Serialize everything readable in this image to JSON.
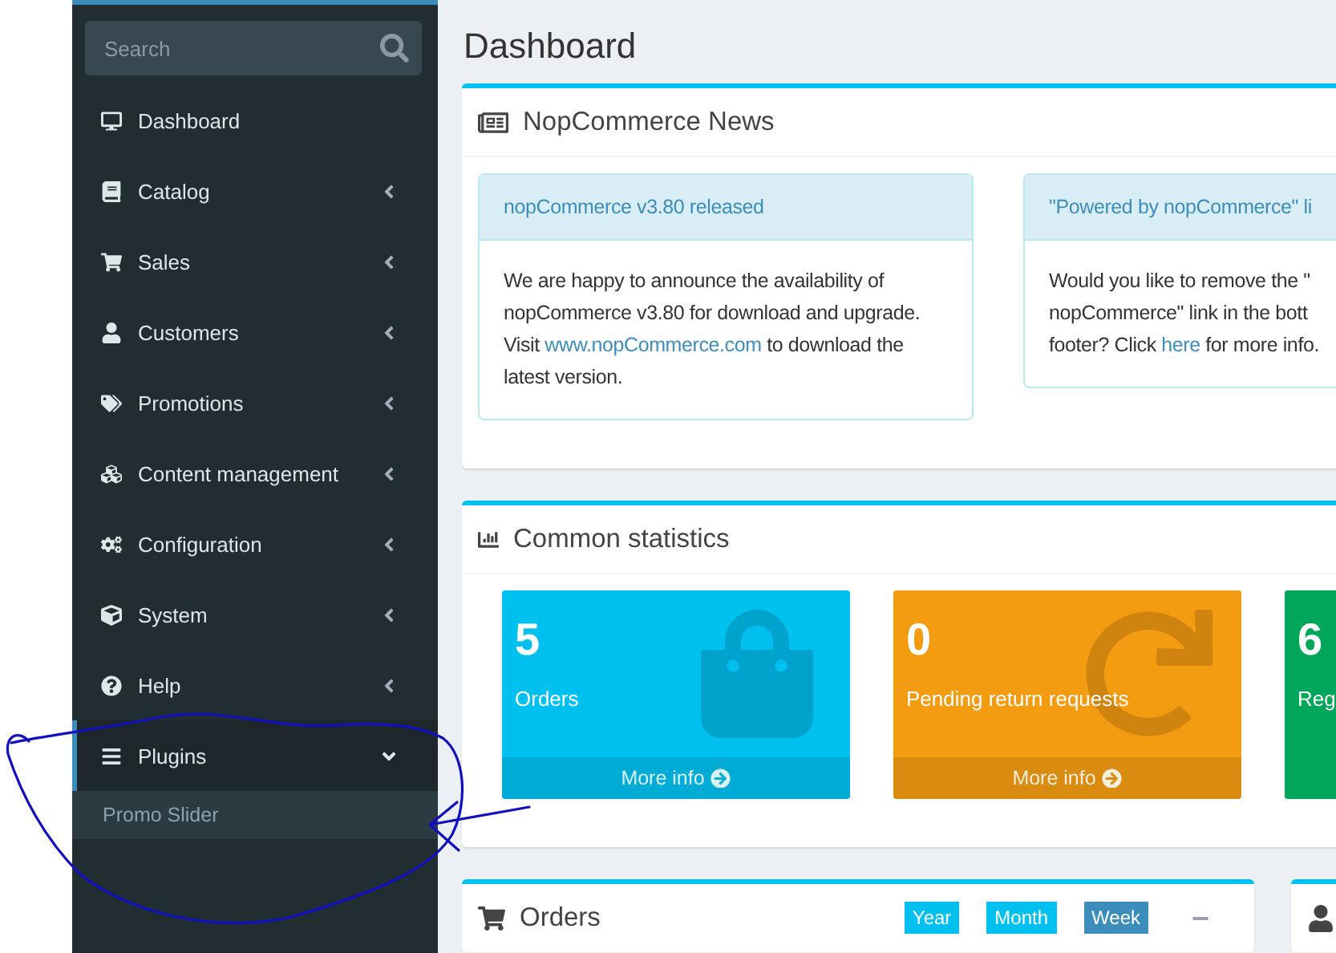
{
  "sidebar": {
    "search": {
      "placeholder": "Search"
    },
    "items": [
      {
        "label": "Dashboard",
        "kind": "link",
        "expanded": false
      },
      {
        "label": "Catalog",
        "kind": "menu",
        "expanded": false
      },
      {
        "label": "Sales",
        "kind": "menu",
        "expanded": false
      },
      {
        "label": "Customers",
        "kind": "menu",
        "expanded": false
      },
      {
        "label": "Promotions",
        "kind": "menu",
        "expanded": false
      },
      {
        "label": "Content management",
        "kind": "menu",
        "expanded": false
      },
      {
        "label": "Configuration",
        "kind": "menu",
        "expanded": false
      },
      {
        "label": "System",
        "kind": "menu",
        "expanded": false
      },
      {
        "label": "Help",
        "kind": "menu",
        "expanded": false
      },
      {
        "label": "Plugins",
        "kind": "menu",
        "expanded": true,
        "children": [
          {
            "label": "Promo Slider"
          }
        ]
      }
    ]
  },
  "page_title": "Dashboard",
  "news": {
    "title": "NopCommerce News",
    "items": [
      {
        "title": "nopCommerce v3.80 released",
        "body": [
          {
            "text": "We are happy to announce the availability of nopCommerce v3.80 for download and upgrade. Visit "
          },
          {
            "text": "www.nopCommerce.com",
            "link": true
          },
          {
            "text": " to download the latest version."
          }
        ]
      },
      {
        "title": "\"Powered by nopCommerce\" li",
        "body": [
          {
            "text": "Would you like to remove the \"\nnopCommerce\" link in the bott\nfooter? Click "
          },
          {
            "text": "here",
            "link": true
          },
          {
            "text": " for more info."
          }
        ]
      }
    ]
  },
  "statistics": {
    "title": "Common statistics",
    "tiles": [
      {
        "value": "5",
        "label": "Orders",
        "footer": "More info",
        "color": "#00c0ef"
      },
      {
        "value": "0",
        "label": "Pending return requests",
        "footer": "More info",
        "color": "#f39c12"
      },
      {
        "value": "6",
        "label": "Reg",
        "color": "#00a65a"
      }
    ]
  },
  "orders": {
    "title": "Orders",
    "ranges": [
      {
        "label": "Year",
        "selected": false
      },
      {
        "label": "Month",
        "selected": false
      },
      {
        "label": "Week",
        "selected": true
      }
    ]
  }
}
